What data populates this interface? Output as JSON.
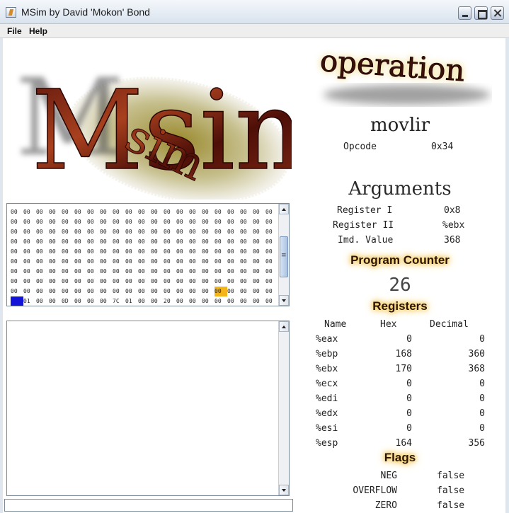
{
  "window": {
    "title": "MSim by David 'Mokon' Bond"
  },
  "menu": {
    "file": "File",
    "help": "Help"
  },
  "logo": {
    "text": "Msim"
  },
  "memory": {
    "rows": [
      [
        "00",
        "00",
        "00",
        "00",
        "00",
        "00",
        "00",
        "00",
        "00",
        "00",
        "00",
        "00",
        "00",
        "00",
        "00",
        "00",
        "00",
        "00",
        "00",
        "00",
        "00"
      ],
      [
        "00",
        "00",
        "00",
        "00",
        "00",
        "00",
        "00",
        "00",
        "00",
        "00",
        "00",
        "00",
        "00",
        "00",
        "00",
        "00",
        "00",
        "00",
        "00",
        "00",
        "00"
      ],
      [
        "00",
        "00",
        "00",
        "00",
        "00",
        "00",
        "00",
        "00",
        "00",
        "00",
        "00",
        "00",
        "00",
        "00",
        "00",
        "00",
        "00",
        "00",
        "00",
        "00",
        "00"
      ],
      [
        "00",
        "00",
        "00",
        "00",
        "00",
        "00",
        "00",
        "00",
        "00",
        "00",
        "00",
        "00",
        "00",
        "00",
        "00",
        "00",
        "00",
        "00",
        "00",
        "00",
        "00"
      ],
      [
        "00",
        "00",
        "00",
        "00",
        "00",
        "00",
        "00",
        "00",
        "00",
        "00",
        "00",
        "00",
        "00",
        "00",
        "00",
        "00",
        "00",
        "00",
        "00",
        "00",
        "00"
      ],
      [
        "00",
        "00",
        "00",
        "00",
        "00",
        "00",
        "00",
        "00",
        "00",
        "00",
        "00",
        "00",
        "00",
        "00",
        "00",
        "00",
        "00",
        "00",
        "00",
        "00",
        "00"
      ],
      [
        "00",
        "00",
        "00",
        "00",
        "00",
        "00",
        "00",
        "00",
        "00",
        "00",
        "00",
        "00",
        "00",
        "00",
        "00",
        "00",
        "00",
        "00",
        "00",
        "00",
        "00"
      ],
      [
        "00",
        "00",
        "00",
        "00",
        "00",
        "00",
        "00",
        "00",
        "00",
        "00",
        "00",
        "00",
        "00",
        "00",
        "00",
        "00",
        "00",
        "00",
        "00",
        "00",
        "00"
      ],
      [
        "00",
        "00",
        "00",
        "00",
        "00",
        "00",
        "00",
        "00",
        "00",
        "00",
        "00",
        "00",
        "00",
        "00",
        "00",
        "00",
        "00",
        "00",
        "00",
        "00",
        "00"
      ],
      [
        "",
        "01",
        "00",
        "00",
        "0D",
        "00",
        "00",
        "00",
        "7C",
        "01",
        "00",
        "00",
        "20",
        "00",
        "00",
        "00",
        "00",
        "00",
        "00",
        "00",
        "00"
      ]
    ],
    "highlighted": {
      "row": 8,
      "col": 16
    },
    "cursor": {
      "row": 9,
      "col": 0
    },
    "scroll_fraction": 0.55
  },
  "operation": {
    "heading": "operation",
    "instruction": "movlir",
    "opcode_label": "Opcode",
    "opcode_value": "0x34"
  },
  "arguments": {
    "heading": "Arguments",
    "items": [
      {
        "label": "Register I",
        "value": "0x8"
      },
      {
        "label": "Register II",
        "value": "%ebx"
      },
      {
        "label": "Imd. Value",
        "value": "368"
      }
    ]
  },
  "program_counter": {
    "heading": "Program Counter",
    "value": "26"
  },
  "registers": {
    "heading": "Registers",
    "columns": [
      "Name",
      "Hex",
      "Decimal"
    ],
    "rows": [
      {
        "name": "%eax",
        "hex": "0",
        "dec": "0"
      },
      {
        "name": "%ebp",
        "hex": "168",
        "dec": "360"
      },
      {
        "name": "%ebx",
        "hex": "170",
        "dec": "368"
      },
      {
        "name": "%ecx",
        "hex": "0",
        "dec": "0"
      },
      {
        "name": "%edi",
        "hex": "0",
        "dec": "0"
      },
      {
        "name": "%edx",
        "hex": "0",
        "dec": "0"
      },
      {
        "name": "%esi",
        "hex": "0",
        "dec": "0"
      },
      {
        "name": "%esp",
        "hex": "164",
        "dec": "356"
      }
    ]
  },
  "flags": {
    "heading": "Flags",
    "rows": [
      {
        "name": "NEG",
        "value": "false"
      },
      {
        "name": "OVERFLOW",
        "value": "false"
      },
      {
        "name": "ZERO",
        "value": "false"
      }
    ]
  }
}
